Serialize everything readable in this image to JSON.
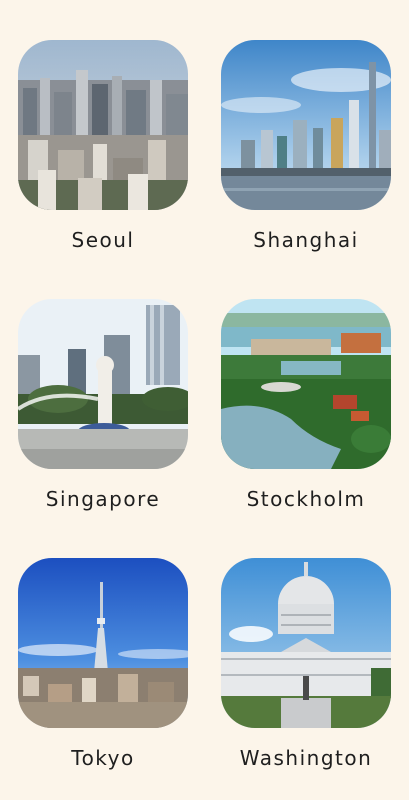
{
  "cities": [
    {
      "name": "Seoul"
    },
    {
      "name": "Shanghai"
    },
    {
      "name": "Singapore"
    },
    {
      "name": "Stockholm"
    },
    {
      "name": "Tokyo"
    },
    {
      "name": "Washington"
    }
  ]
}
